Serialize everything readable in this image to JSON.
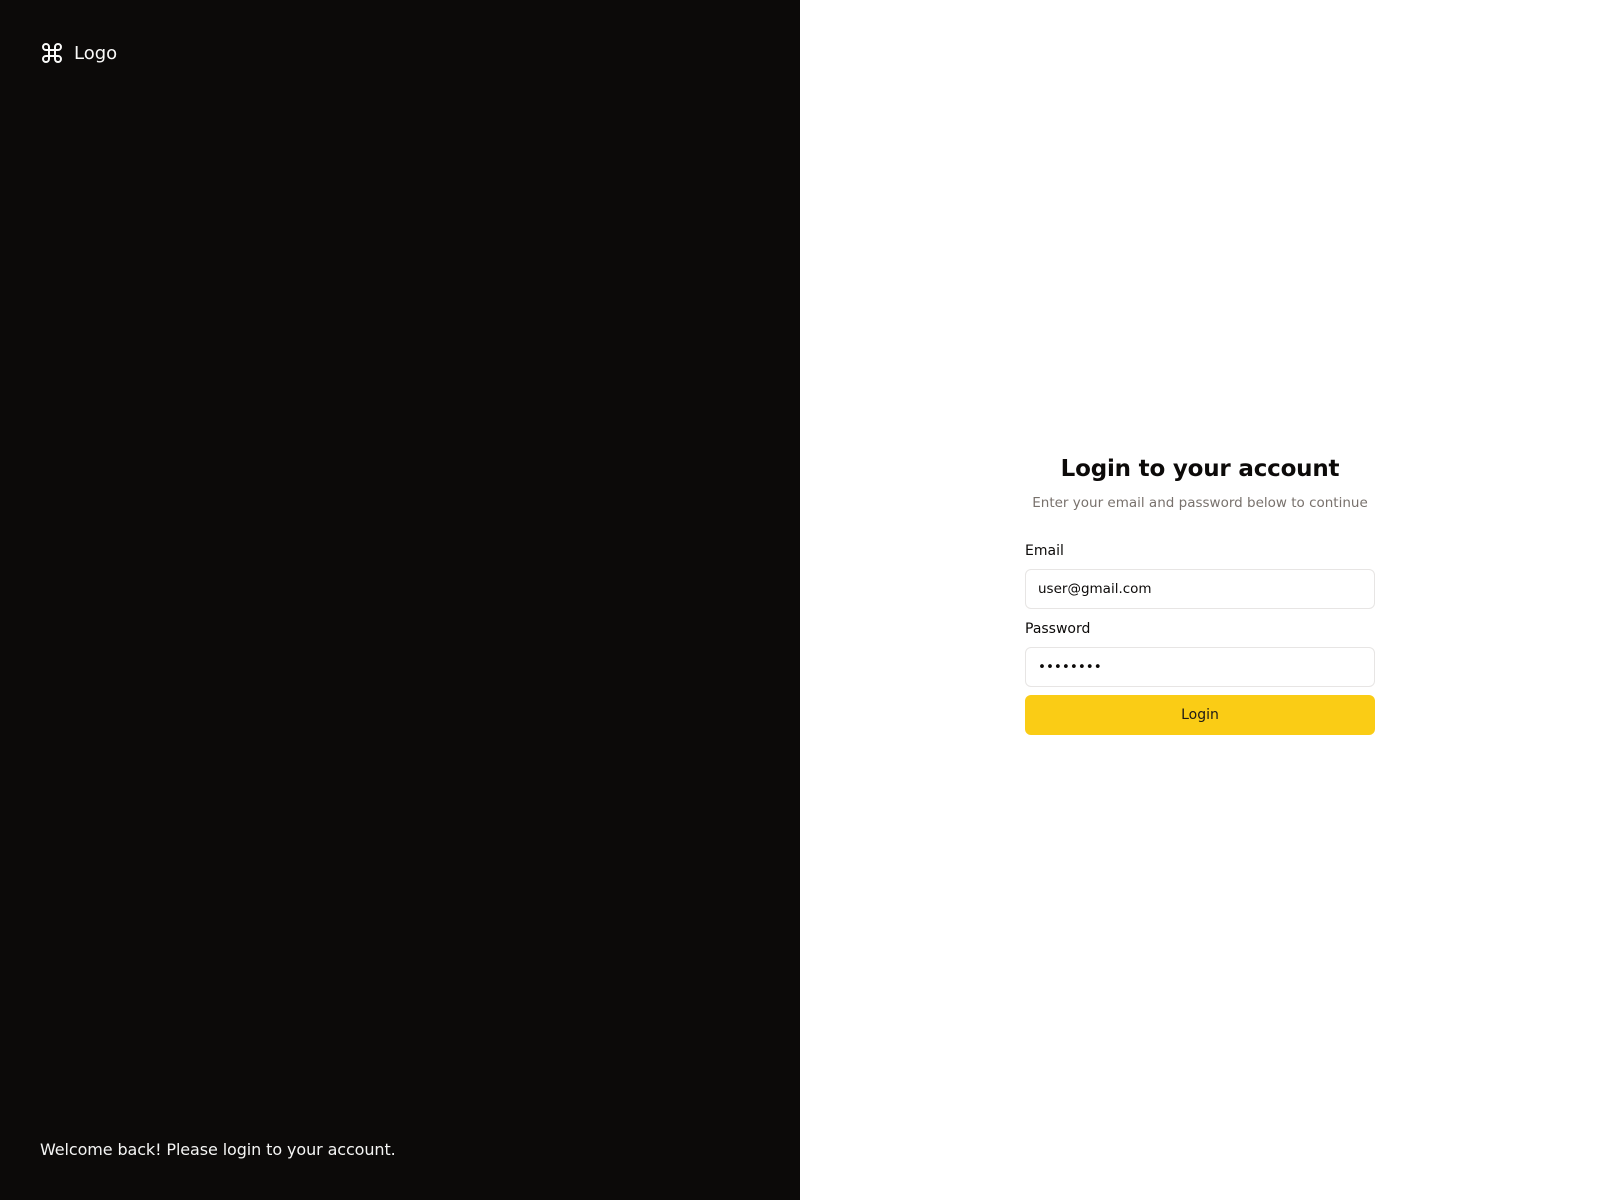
{
  "brand": {
    "icon": "command-icon",
    "name": "Logo"
  },
  "left_panel": {
    "background": "#0c0a09",
    "welcome_text": "Welcome back! Please login to your account."
  },
  "login_form": {
    "title": "Login to your account",
    "subtitle": "Enter your email and password below to continue",
    "email": {
      "label": "Email",
      "value": "user@gmail.com"
    },
    "password": {
      "label": "Password",
      "value": "password"
    },
    "submit_label": "Login",
    "accent_color": "#facc15"
  }
}
